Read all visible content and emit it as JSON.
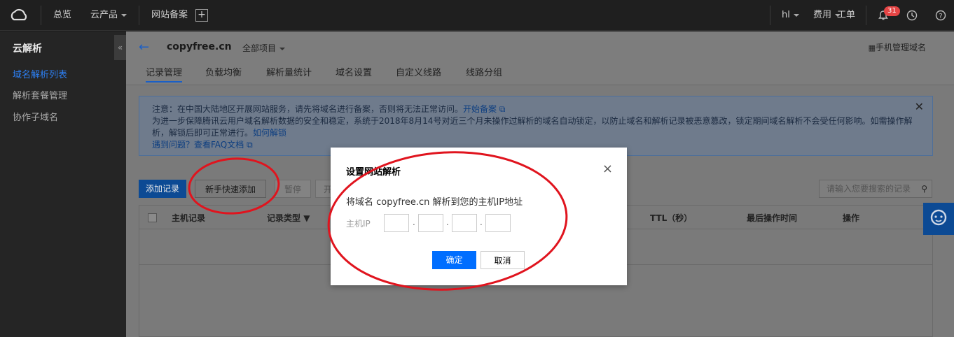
{
  "topbar": {
    "overview": "总览",
    "products": "云产品",
    "icp": "网站备案",
    "user": "hl",
    "billing": "费用",
    "tickets": "工单",
    "notification_count": "31"
  },
  "sidebar": {
    "title": "云解析",
    "collapse": "«",
    "items": [
      {
        "label": "域名解析列表"
      },
      {
        "label": "解析套餐管理"
      },
      {
        "label": "协作子域名"
      }
    ]
  },
  "main": {
    "back": "←",
    "domain": "copyfree.cn",
    "project": "全部项目",
    "phone_manage": "手机管理域名",
    "tabs": [
      "记录管理",
      "负载均衡",
      "解析量统计",
      "域名设置",
      "自定义线路",
      "线路分组"
    ]
  },
  "notice": {
    "line1": "注意：在中国大陆地区开展网站服务，请先将域名进行备案，否则将无法正常访问。",
    "line1_link": "开始备案",
    "line2": "为进一步保障腾讯云用户域名解析数据的安全和稳定，系统于2018年8月14号对近三个月未操作过解析的域名自动锁定，以防止域名和解析记录被恶意篡改，锁定期间域名解析不会受任何影响。如需操作解析，解锁后即可正常进行。",
    "line2_link": "如何解锁",
    "line3_link": "遇到问题？查看FAQ文档"
  },
  "toolbar": {
    "add_record": "添加记录",
    "quick_add": "新手快速添加",
    "pause": "暂停",
    "enable": "开",
    "search_placeholder": "请输入您要搜索的记录"
  },
  "table": {
    "headers": [
      "主机记录",
      "记录类型",
      "TTL（秒）",
      "最后操作时间",
      "操作"
    ]
  },
  "dialog": {
    "title": "设置网站解析",
    "description": "将域名 copyfree.cn 解析到您的主机IP地址",
    "ip_label": "主机IP",
    "ip_values": [
      "",
      "",
      "",
      ""
    ],
    "confirm": "确定",
    "cancel": "取消",
    "close": "×"
  },
  "colors": {
    "accent": "#006eff",
    "annotation": "#e0141e"
  }
}
